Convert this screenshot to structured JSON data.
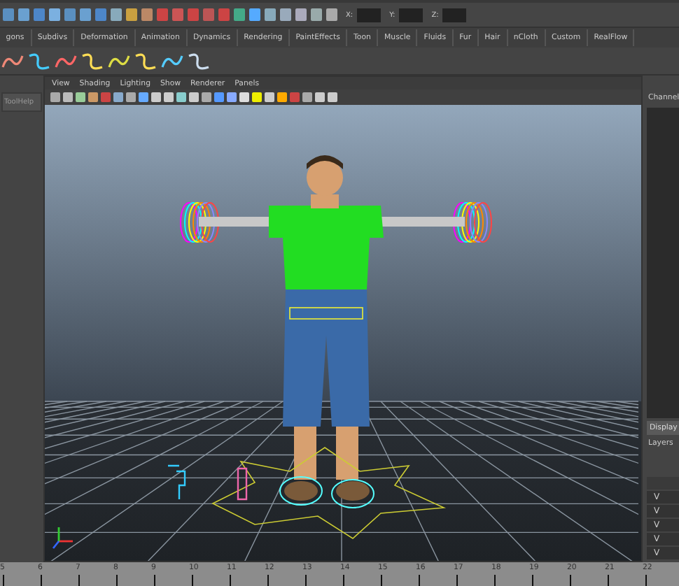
{
  "toolbar": {
    "fields": [
      {
        "label": "X:"
      },
      {
        "label": "Y:"
      },
      {
        "label": "Z:"
      }
    ]
  },
  "shelf_tabs": [
    "gons",
    "Subdivs",
    "Deformation",
    "Animation",
    "Dynamics",
    "Rendering",
    "PaintEffects",
    "Toon",
    "Muscle",
    "Fluids",
    "Fur",
    "Hair",
    "nCloth",
    "Custom",
    "RealFlow"
  ],
  "tool_help": "ToolHelp",
  "viewport": {
    "menus": [
      "View",
      "Shading",
      "Lighting",
      "Show",
      "Renderer",
      "Panels"
    ]
  },
  "channel_box": {
    "title": "Channel",
    "tabs": [
      {
        "label": "Display",
        "selected": true
      }
    ],
    "layers_label": "Layers",
    "rows": [
      {
        "label": "V"
      },
      {
        "label": "V"
      },
      {
        "label": "V"
      },
      {
        "label": "V"
      },
      {
        "label": "V"
      }
    ]
  },
  "timeline": {
    "frames": [
      "5",
      "6",
      "7",
      "8",
      "9",
      "10",
      "11",
      "12",
      "13",
      "14",
      "15",
      "16",
      "17",
      "18",
      "19",
      "20",
      "21",
      "22"
    ]
  }
}
